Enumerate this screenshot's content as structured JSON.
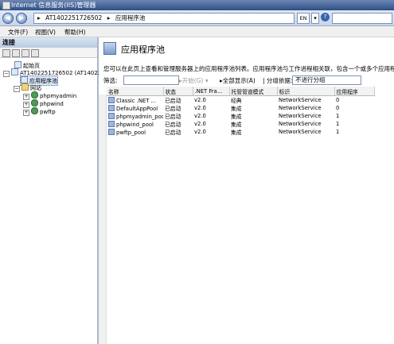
{
  "titlebar": {
    "title": "Internet 信息服务(IIS)管理器"
  },
  "address": {
    "segments": [
      "AT1402251726502",
      "应用程序池"
    ],
    "lang": "EN"
  },
  "menu": {
    "file": "文件(F)",
    "view": "视图(V)",
    "help": "帮助(H)"
  },
  "connections": {
    "header": "连接",
    "tree": {
      "start": "起始页",
      "server": "AT1402251726502 (AT1402251",
      "apppools": "应用程序池",
      "sites": "网站",
      "site1": "phpmyadmin",
      "site2": "phpwind",
      "site3": "pwftp"
    }
  },
  "main": {
    "title": "应用程序池",
    "description": "您可以在此页上查看和管理服务器上的应用程序池列表。应用程序池与工作进程相关联，包含一个或多个应用程序，",
    "filter_label": "筛选:",
    "go_label": "开始(G)",
    "showall_label": "全部显示(A)",
    "groupby_label": "分组依据:",
    "groupby_value": "不进行分组",
    "columns": [
      "名称",
      "状态",
      ".NET Fra...",
      "托管管道模式",
      "标识",
      "应用程序"
    ],
    "rows": [
      [
        "Classic .NET ...",
        "已启动",
        "v2.0",
        "经典",
        "NetworkService",
        "0"
      ],
      [
        "DefaultAppPool",
        "已启动",
        "v2.0",
        "集成",
        "NetworkService",
        "0"
      ],
      [
        "phpmyadmin_pool",
        "已启动",
        "v2.0",
        "集成",
        "NetworkService",
        "1"
      ],
      [
        "phpwind_pool",
        "已启动",
        "v2.0",
        "集成",
        "NetworkService",
        "1"
      ],
      [
        "pwftp_pool",
        "已启动",
        "v2.0",
        "集成",
        "NetworkService",
        "1"
      ]
    ]
  }
}
